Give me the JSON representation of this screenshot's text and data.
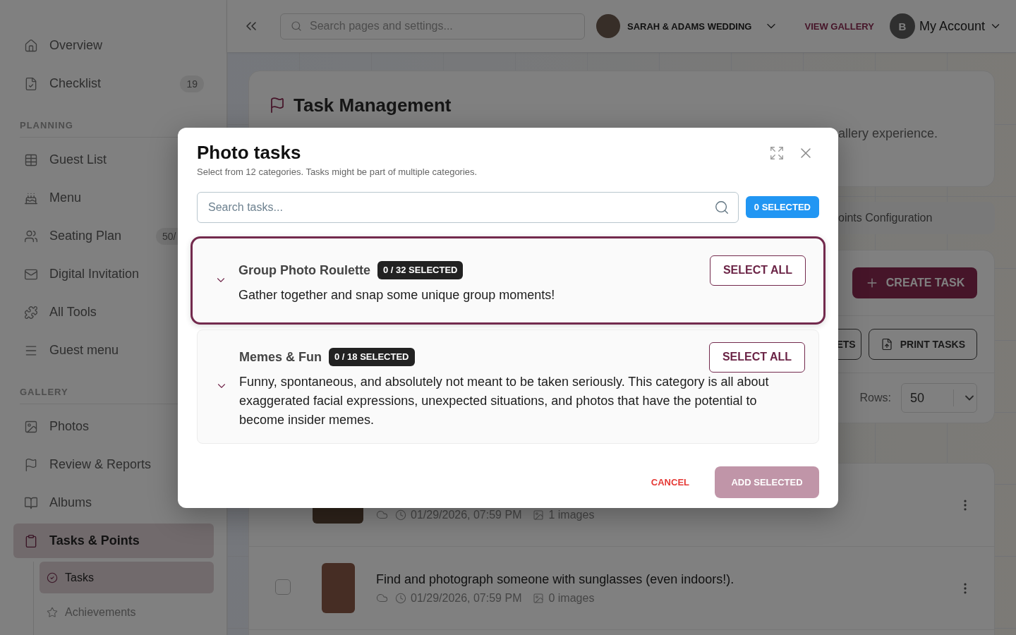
{
  "sidebar": {
    "items": [
      {
        "label": "Overview",
        "selected": false
      },
      {
        "label": "Checklist",
        "selected": false,
        "badge": {
          "kind": "count",
          "text": "19"
        }
      }
    ],
    "sections": [
      {
        "title": "PLANNING",
        "items": [
          {
            "label": "Guest List",
            "selected": false
          },
          {
            "label": "Menu",
            "selected": false
          },
          {
            "label": "Seating Plan",
            "selected": false,
            "badge": {
              "kind": "ratio",
              "text": "50/"
            }
          },
          {
            "label": "Digital Invitation",
            "selected": false
          },
          {
            "label": "All Tools",
            "selected": false
          },
          {
            "label": "Guest menu",
            "selected": false
          }
        ]
      },
      {
        "title": "GALLERY",
        "items": [
          {
            "label": "Photos",
            "selected": false
          },
          {
            "label": "Review & Reports",
            "selected": false
          },
          {
            "label": "Albums",
            "selected": false
          },
          {
            "label": "Tasks & Points",
            "selected": true,
            "children": [
              {
                "label": "Tasks",
                "selected": true
              },
              {
                "label": "Achievements",
                "selected": false
              }
            ]
          }
        ]
      }
    ]
  },
  "topbar": {
    "search": {
      "placeholder": "Search pages and settings..."
    },
    "event": "SARAH & ADAMS WEDDING",
    "link": "VIEW GALLERY",
    "account": {
      "initial": "B",
      "label": "My Account"
    }
  },
  "page": {
    "title": "Task Management",
    "description": "allery experience.",
    "tab": "oints Configuration",
    "create_button": "CREATE TASK",
    "buttons": [
      {
        "label": "ETS"
      },
      {
        "label": "PRINT TASKS"
      }
    ],
    "rows": {
      "label": "Rows:",
      "value": "50"
    },
    "tasks": [
      {
        "kind": "landscape",
        "date": "01/29/2026, 07:59 PM",
        "images": "1 images"
      },
      {
        "kind": "portrait",
        "checked": false,
        "title": "Find and photograph someone with sunglasses (even indoors!).",
        "date": "01/29/2026, 07:59 PM",
        "images": "0 images"
      }
    ]
  },
  "dialog": {
    "title": "Photo tasks",
    "subtitle": "Select from 12 categories. Tasks might be part of multiple categories.",
    "search": {
      "placeholder": "Search tasks..."
    },
    "selected_count": "0 SELECTED",
    "categories": [
      {
        "name": "Group Photo Roulette",
        "count": "0 / 32 SELECTED",
        "description": "Gather together and snap some unique group moments!",
        "action": "SELECT ALL",
        "selected": true,
        "expanded": false
      },
      {
        "name": "Memes & Fun",
        "count": "0 / 18 SELECTED",
        "description": "Funny, spontaneous, and absolutely not meant to be taken seriously. This category is all about exaggerated facial expressions, unexpected situations, and photos that have the potential to become insider memes.",
        "action": "SELECT ALL",
        "selected": false,
        "expanded": false
      }
    ],
    "cancel": "CANCEL",
    "add": {
      "label": "ADD SELECTED",
      "disabled": true
    }
  }
}
